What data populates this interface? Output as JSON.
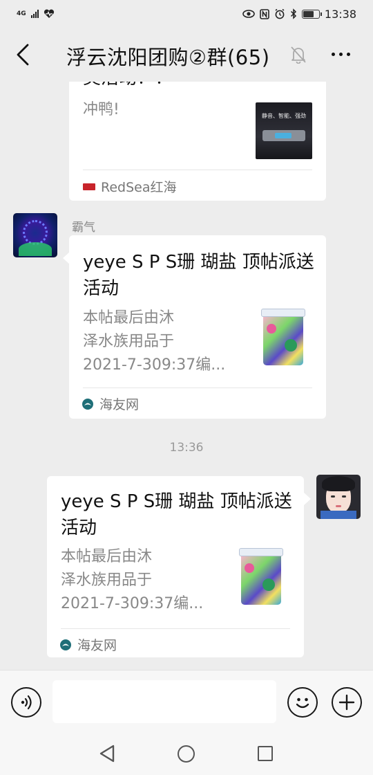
{
  "status_bar": {
    "network": "4G",
    "time": "13:38",
    "icons": [
      "signal-icon",
      "heart-rate-icon",
      "eye-comfort-icon",
      "nfc-icon",
      "alarm-icon",
      "bluetooth-icon",
      "battery-icon"
    ],
    "battery_level": 0.7
  },
  "header": {
    "title": "浮云沈阳团购②群(65)",
    "icons": [
      "back-arrow-icon",
      "mute-bell-icon",
      "more-icon"
    ]
  },
  "messages": [
    {
      "type": "link-card",
      "side": "left",
      "title_partial": "奖活动！！",
      "description": "冲鸭!",
      "thumbnail": "product-banner-icon",
      "thumbnail_caption": "静音、智能、强劲",
      "source": "RedSea红海",
      "source_icon": "redsea-logo-icon"
    },
    {
      "type": "link-card",
      "side": "left",
      "sender": "霸气",
      "title": "yeye S P S珊 瑚盐 顶帖派送活动",
      "description_lines": [
        "本帖最后由沐",
        "泽水族用品于",
        "2021-7-309:37编..."
      ],
      "thumbnail": "salt-bucket-icon",
      "source": "海友网",
      "source_icon": "haiyou-logo-icon"
    },
    {
      "type": "timestamp",
      "text": "13:36"
    },
    {
      "type": "link-card",
      "side": "right",
      "title": "yeye S P S珊 瑚盐 顶帖派送活动",
      "description_lines": [
        "本帖最后由沐",
        "泽水族用品于",
        "2021-7-309:37编..."
      ],
      "thumbnail": "salt-bucket-icon",
      "source": "海友网",
      "source_icon": "haiyou-logo-icon"
    }
  ],
  "input_bar": {
    "value": "",
    "icons": [
      "voice-icon",
      "emoji-icon",
      "plus-icon"
    ]
  },
  "nav_bar": {
    "icons": [
      "nav-back-icon",
      "nav-home-icon",
      "nav-recent-icon"
    ]
  }
}
